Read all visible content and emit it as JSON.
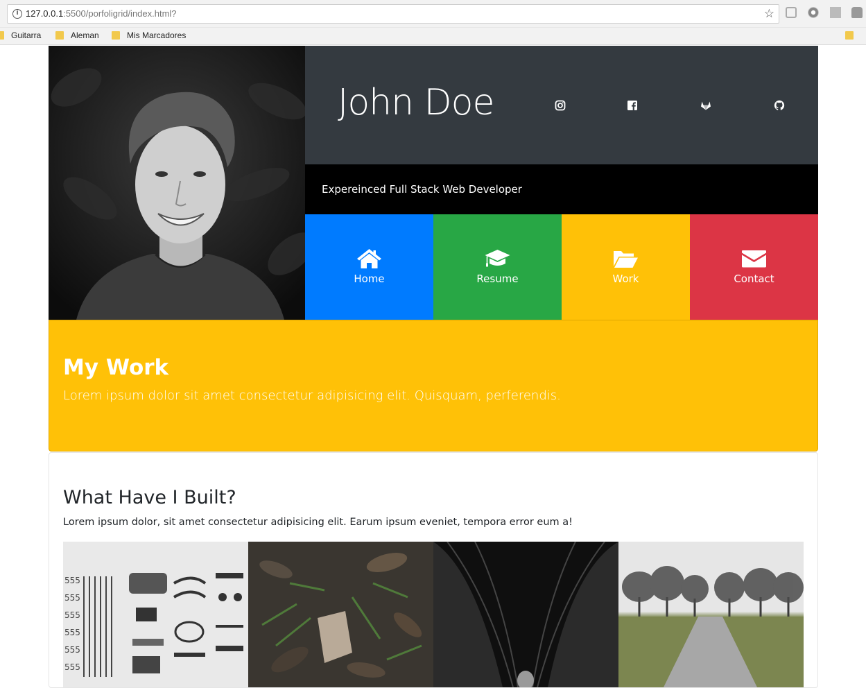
{
  "browser": {
    "url_host": "127.0.0.1",
    "url_path": ":5500/porfoligrid/index.html?",
    "bookmarks": [
      "Guitarra",
      "Aleman",
      "Mis Marcadores"
    ]
  },
  "hero": {
    "name": "John Doe",
    "tagline": "Expereinced Full Stack Web Developer",
    "social_icons": [
      "instagram-icon",
      "facebook-icon",
      "gitlab-icon",
      "github-icon"
    ],
    "tiles": [
      {
        "label": "Home",
        "icon": "home-icon",
        "color": "#007bff"
      },
      {
        "label": "Resume",
        "icon": "graduation-cap-icon",
        "color": "#28a745"
      },
      {
        "label": "Work",
        "icon": "folder-open-icon",
        "color": "#ffc107"
      },
      {
        "label": "Contact",
        "icon": "envelope-icon",
        "color": "#dc3545"
      }
    ]
  },
  "work": {
    "title": "My Work",
    "subtitle": "Lorem ipsum dolor sit amet consectetur adipisicing elit. Quisquam, perferendis."
  },
  "built": {
    "title": "What Have I Built?",
    "text": "Lorem ipsum dolor, sit amet consectetur adipisicing elit. Earum ipsum eveniet, tempora error eum a!"
  },
  "colors": {
    "dark": "#343a40",
    "black": "#000000",
    "yellow": "#ffc107"
  }
}
